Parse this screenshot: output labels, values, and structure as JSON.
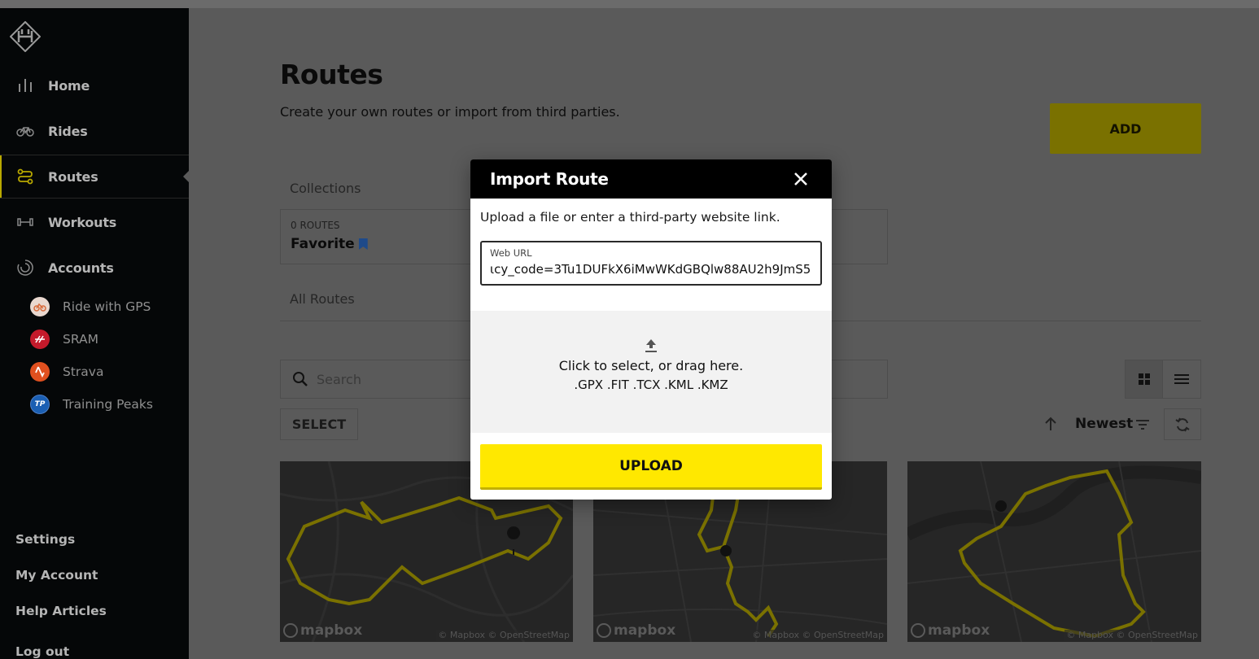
{
  "sidebar": {
    "nav": [
      {
        "label": "Home",
        "icon": "bars-icon"
      },
      {
        "label": "Rides",
        "icon": "bike-icon"
      },
      {
        "label": "Routes",
        "icon": "route-icon",
        "active": true
      },
      {
        "label": "Workouts",
        "icon": "dumbbell-icon"
      },
      {
        "label": "Accounts",
        "icon": "accounts-icon"
      }
    ],
    "accounts": [
      {
        "label": "Ride with GPS",
        "color": "#d86a3a"
      },
      {
        "label": "SRAM",
        "color": "#c41a2b"
      },
      {
        "label": "Strava",
        "color": "#e0501f"
      },
      {
        "label": "Training Peaks",
        "badge": "TP",
        "color": "#1b5fb3"
      }
    ],
    "footer": [
      "Settings",
      "My Account",
      "Help Articles",
      "Log out"
    ]
  },
  "main": {
    "title": "Routes",
    "subtitle": "Create your own routes or import from third parties.",
    "add_label": "ADD",
    "collections_label": "Collections",
    "collection": {
      "count": "0 ROUTES",
      "name": "Favorite"
    },
    "all_routes_label": "All Routes",
    "search_placeholder": "Search",
    "select_label": "SELECT",
    "sort_label": "Newest",
    "map_cards": [
      {
        "brand": "mapbox",
        "attribution": "© Mapbox © OpenStreetMap"
      },
      {
        "brand": "mapbox",
        "attribution": "© Mapbox © OpenStreetMap"
      },
      {
        "brand": "mapbox",
        "attribution": "© Mapbox © OpenStreetMap"
      }
    ]
  },
  "modal": {
    "title": "Import Route",
    "description": "Upload a file or enter a third-party website link.",
    "url_label": "Web URL",
    "url_value": "ɩcy_code=3Tu1DUFkX6iMwWKdGBQlw88AU2h9JmS5",
    "drop_text": "Click to select, or drag here.",
    "drop_types": ".GPX .FIT .TCX .KML .KMZ",
    "upload_label": "UPLOAD"
  },
  "colors": {
    "accent": "#ffe800",
    "sidebar": "#050708"
  }
}
